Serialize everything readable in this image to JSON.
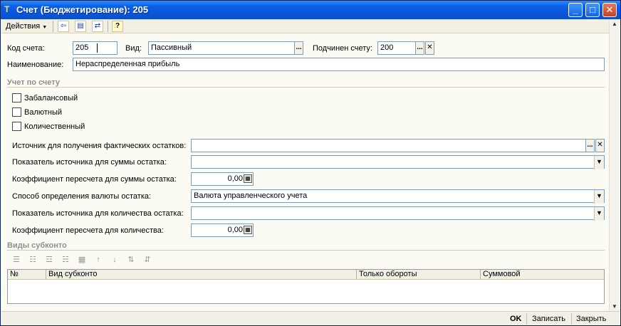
{
  "window": {
    "title": "Счет (Бюджетирование): 205",
    "minimize": "_",
    "maximize": "□",
    "close": "✕"
  },
  "toolbar": {
    "actions_label": "Действия",
    "help_icon_text": "?"
  },
  "form": {
    "code_label": "Код счета:",
    "code_value": "205",
    "kind_label": "Вид:",
    "kind_value": "Пассивный",
    "parent_label": "Подчинен счету:",
    "parent_value": "200",
    "name_label": "Наименование:",
    "name_value": "Нераспределенная прибыль"
  },
  "account_section": {
    "title": "Учет по счету",
    "offbalance_label": "Забалансовый",
    "currency_label": "Валютный",
    "quantity_label": "Количественный"
  },
  "settings": {
    "source_label": "Источник для получения фактических остатков:",
    "source_value": "",
    "sum_indicator_label": "Показатель источника для суммы остатка:",
    "sum_indicator_value": "",
    "sum_coef_label": "Коэффициент пересчета для суммы остатка:",
    "sum_coef_value": "0,00",
    "currency_method_label": "Способ определения валюты остатка:",
    "currency_method_value": "Валюта управленческого учета",
    "qty_indicator_label": "Показатель источника для количества остатка:",
    "qty_indicator_value": "",
    "qty_coef_label": "Коэффициент пересчета для количества:",
    "qty_coef_value": "0,00"
  },
  "subconto": {
    "title": "Виды субконто",
    "columns": [
      "№",
      "Вид субконто",
      "Только обороты",
      "Суммовой"
    ]
  },
  "footer": {
    "ok_label": "OK",
    "save_label": "Записать",
    "close_label": "Закрыть"
  },
  "icons": {
    "select_glyph": "...",
    "clear_glyph": "✕",
    "dropdown_glyph": "▼",
    "calc_glyph": "▦"
  }
}
